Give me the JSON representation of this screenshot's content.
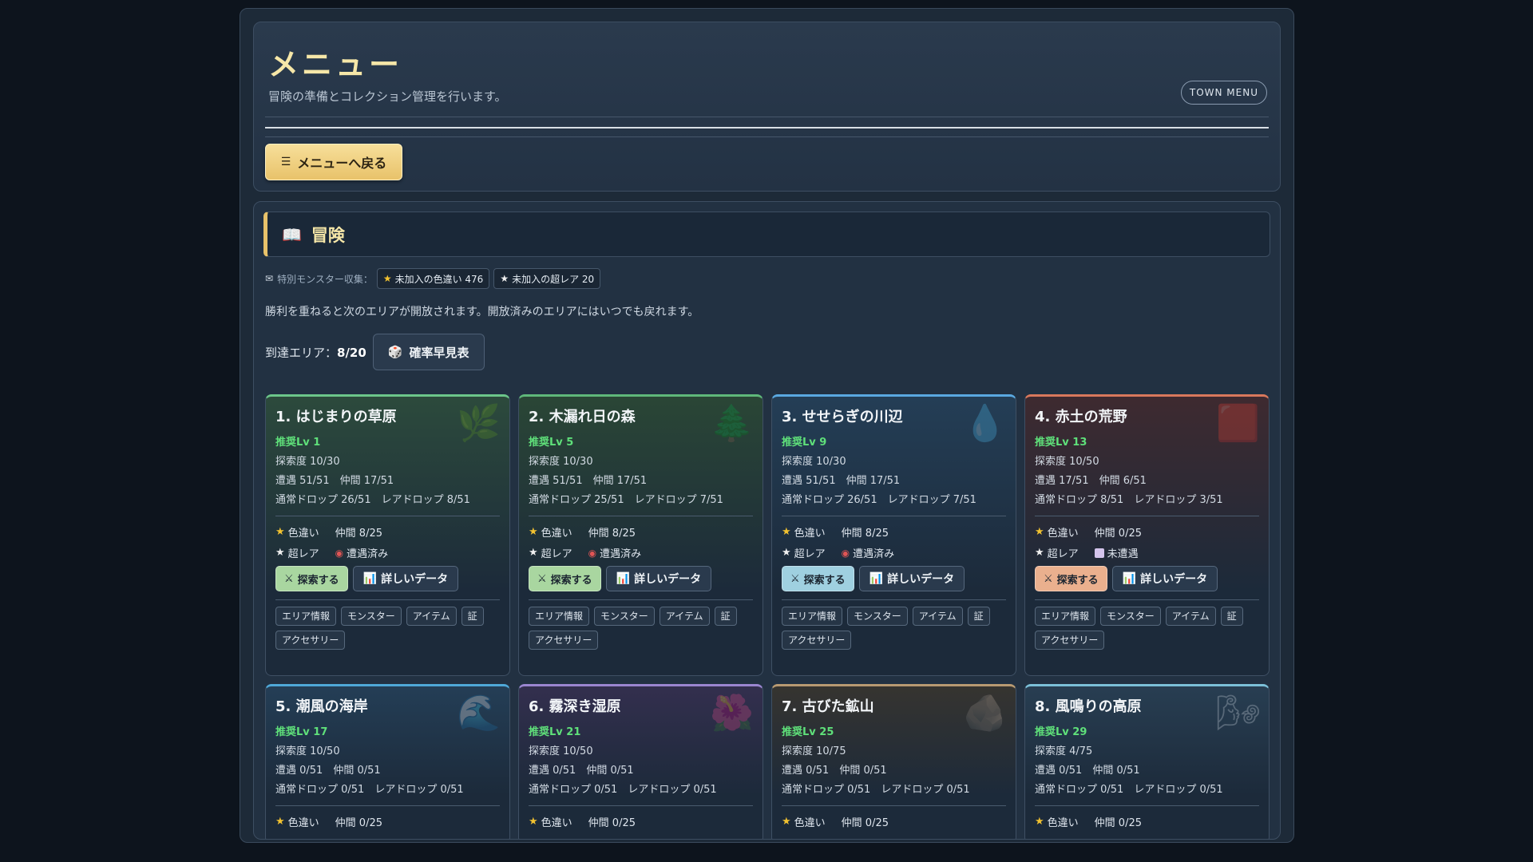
{
  "header": {
    "title": "メニュー",
    "subtitle": "冒険の準備とコレクション管理を行います。",
    "badge": "TOWN MENU",
    "back_label": "メニューへ戻る"
  },
  "adventure": {
    "title": "冒険",
    "collect_label": "特別モンスター収集：",
    "chip_shiny": "未加入の色違い 476",
    "chip_rare": "未加入の超レア 20",
    "info": "勝利を重ねると次のエリアが開放されます。開放済みのエリアにはいつでも戻れます。",
    "reach_label": "到達エリア：",
    "reach_value": "8/20",
    "prob_button": "確率早見表"
  },
  "labels": {
    "shiny": "色違い",
    "rare": "超レア",
    "explore": "探索する",
    "detail": "詳しいデータ"
  },
  "tags": [
    "エリア情報",
    "モンスター",
    "アイテム",
    "証",
    "アクセサリー"
  ],
  "colors": {
    "gold": "#e8c26a",
    "rec_level": "#5fe07a"
  },
  "areas": [
    {
      "title": "1. はじまりの草原",
      "icon": "leaf-icon",
      "lv": "推奨Lv 1",
      "explore": "探索度 10/30",
      "enc": "遭遇 51/51　仲間 17/51",
      "drop": "通常ドロップ 26/51　レアドロップ 8/51",
      "shiny_line": "仲間 8/25",
      "rare_status": "遭遇済み",
      "accent": "#6cc68a"
    },
    {
      "title": "2. 木漏れ日の森",
      "icon": "tree-icon",
      "lv": "推奨Lv 5",
      "explore": "探索度 10/30",
      "enc": "遭遇 51/51　仲間 17/51",
      "drop": "通常ドロップ 25/51　レアドロップ 7/51",
      "shiny_line": "仲間 8/25",
      "rare_status": "遭遇済み",
      "accent": "#5fb87a"
    },
    {
      "title": "3. せせらぎの川辺",
      "icon": "droplet-icon",
      "lv": "推奨Lv 9",
      "explore": "探索度 10/30",
      "enc": "遭遇 51/51　仲間 17/51",
      "drop": "通常ドロップ 26/51　レアドロップ 7/51",
      "shiny_line": "仲間 8/25",
      "rare_status": "遭遇済み",
      "accent": "#5aa8e0"
    },
    {
      "title": "4. 赤土の荒野",
      "icon": "red-square-icon",
      "lv": "推奨Lv 13",
      "explore": "探索度 10/50",
      "enc": "遭遇 17/51　仲間 6/51",
      "drop": "通常ドロップ 8/51　レアドロップ 3/51",
      "shiny_line": "仲間 0/25",
      "rare_status": "未遭遇",
      "accent": "#d9785c"
    },
    {
      "title": "5. 潮風の海岸",
      "icon": "wave-icon",
      "lv": "推奨Lv 17",
      "explore": "探索度 10/50",
      "enc": "遭遇 0/51　仲間 0/51",
      "drop": "通常ドロップ 0/51　レアドロップ 0/51",
      "shiny_line": "仲間 0/25",
      "accent": "#4fa8d8"
    },
    {
      "title": "6. 霧深き湿原",
      "icon": "flower-icon",
      "lv": "推奨Lv 21",
      "explore": "探索度 10/50",
      "enc": "遭遇 0/51　仲間 0/51",
      "drop": "通常ドロップ 0/51　レアドロップ 0/51",
      "shiny_line": "仲間 0/25",
      "accent": "#9a86d0"
    },
    {
      "title": "7. 古びた鉱山",
      "icon": "rock-icon",
      "lv": "推奨Lv 25",
      "explore": "探索度 10/75",
      "enc": "遭遇 0/51　仲間 0/51",
      "drop": "通常ドロップ 0/51　レアドロップ 0/51",
      "shiny_line": "仲間 0/25",
      "accent": "#b89a72"
    },
    {
      "title": "8. 風鳴りの高原",
      "icon": "wind-icon",
      "lv": "推奨Lv 29",
      "explore": "探索度 4/75",
      "enc": "遭遇 0/51　仲間 0/51",
      "drop": "通常ドロップ 0/51　レアドロップ 0/51",
      "shiny_line": "仲間 0/25",
      "accent": "#7cc0d8"
    }
  ]
}
